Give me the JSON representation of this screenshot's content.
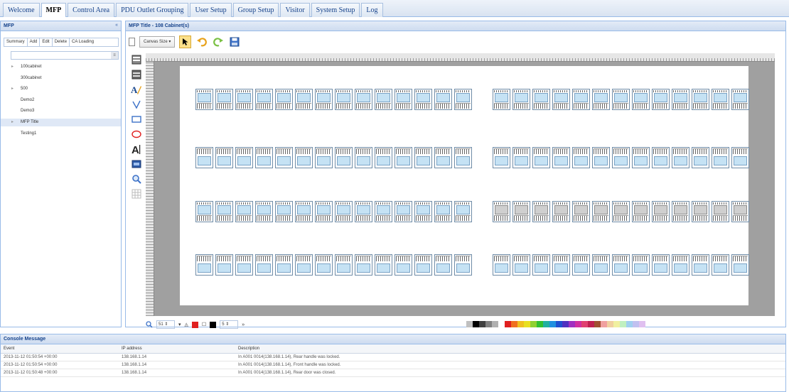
{
  "tabs": [
    "Welcome",
    "MFP",
    "Control Area",
    "PDU Outlet Grouping",
    "User Setup",
    "Group Setup",
    "Visitor",
    "System Setup",
    "Log"
  ],
  "active_tab": "MFP",
  "left_panel": {
    "title": "MFP",
    "collapse": "«",
    "buttons": [
      "Summary",
      "Add",
      "Edit",
      "Delete",
      "CA Loading"
    ],
    "search_placeholder": "",
    "tree": [
      {
        "label": "100cabinet",
        "expandable": true
      },
      {
        "label": "300cabinet",
        "expandable": false
      },
      {
        "label": "500",
        "expandable": true
      },
      {
        "label": "Demo2",
        "expandable": false
      },
      {
        "label": "Demo3",
        "expandable": false
      },
      {
        "label": "MFP Title",
        "expandable": true,
        "selected": true
      },
      {
        "label": "Testing1",
        "expandable": false
      }
    ]
  },
  "main_panel": {
    "title": "MFP Title - 108 Cabinet(s)",
    "canvas_size_label": "Canvas Size",
    "zoom_value": "51",
    "line_width": "5",
    "more": "»"
  },
  "colors": {
    "accent": "#15428b",
    "panel_border": "#99bbe8",
    "rack_face": "#c5e2f4",
    "fill_color": "#e02020",
    "line_color": "#000000"
  },
  "palette": [
    "#c0c0c0",
    "#000000",
    "#404040",
    "#808080",
    "#b0b0b0",
    "#ffffff",
    "#e02020",
    "#f07020",
    "#f0c020",
    "#e8e020",
    "#90d030",
    "#30c030",
    "#20b0a0",
    "#2090e0",
    "#2050d0",
    "#5030c0",
    "#a030c0",
    "#d030a0",
    "#e04070",
    "#c02050",
    "#a05030",
    "#f0a0a0",
    "#f0d0a0",
    "#f0f0a0",
    "#c0f0c0",
    "#a0d0f0",
    "#c0c0f0",
    "#e0c0f0"
  ],
  "console": {
    "title": "Console Message",
    "columns": [
      "Event",
      "IP address",
      "Description"
    ],
    "rows": [
      [
        "2013-11-12 01:50:54 +00:00",
        "138.168.1.14",
        "In A001 0014(138.168.1.14), Rear handle was locked."
      ],
      [
        "2013-11-12 01:50:54 +00:00",
        "138.168.1.14",
        "In A001 0014(138.168.1.14), Front handle was locked."
      ],
      [
        "2013-11-12 01:50:48 +00:00",
        "138.168.1.14",
        "In A001 0014(138.168.1.14), Rear door was closed."
      ]
    ]
  }
}
